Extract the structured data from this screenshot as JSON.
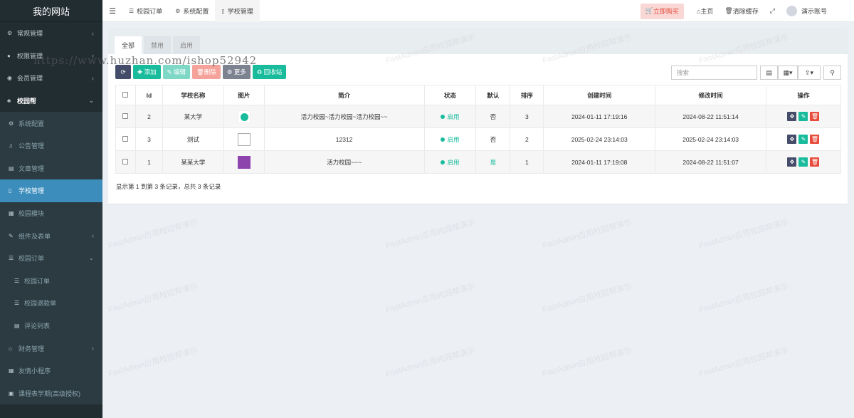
{
  "site_title": "我的网站",
  "overlay_url": "https://www.huzhan.com/ishop52942",
  "watermark": "FastAdmin应用校园帮演示",
  "sidebar": {
    "items": [
      {
        "label": "常规管理",
        "icon": "cogs-icon"
      },
      {
        "label": "权限管理",
        "icon": "users-icon"
      },
      {
        "label": "会员管理",
        "icon": "user-circle-icon"
      },
      {
        "label": "校园帮",
        "icon": "sitemap-icon"
      },
      {
        "label": "系统配置",
        "icon": "cogs-icon"
      },
      {
        "label": "公告管理",
        "icon": "bell-icon"
      },
      {
        "label": "文章管理",
        "icon": "list-alt-icon"
      },
      {
        "label": "学校管理",
        "icon": "file-icon"
      },
      {
        "label": "校园模块",
        "icon": "th-icon"
      },
      {
        "label": "组件及表单",
        "icon": "edit-icon"
      },
      {
        "label": "校园订单",
        "icon": "list-icon"
      },
      {
        "label": "校园订单",
        "icon": "list-icon"
      },
      {
        "label": "校园退款单",
        "icon": "list-icon"
      },
      {
        "label": "评论列表",
        "icon": "list-alt-icon"
      },
      {
        "label": "财务管理",
        "icon": "bank-icon"
      },
      {
        "label": "友情小程序",
        "icon": "th-icon"
      },
      {
        "label": "课程表学期(高级授权)",
        "icon": "calendar-icon"
      }
    ]
  },
  "topbar": {
    "tabs": [
      {
        "label": "校园订单"
      },
      {
        "label": "系统配置"
      },
      {
        "label": "学校管理"
      }
    ],
    "buy": "立即购买",
    "home": "主页",
    "clear_cache": "清除缓存",
    "account": "演示账号"
  },
  "filter_tabs": [
    "全部",
    "禁用",
    "启用"
  ],
  "toolbar": {
    "add": "添加",
    "edit": "编辑",
    "delete": "删除",
    "more": "更多",
    "recycle": "回收站",
    "search_placeholder": "搜索"
  },
  "table": {
    "headers": [
      "Id",
      "学校名称",
      "图片",
      "简介",
      "状态",
      "默认",
      "排序",
      "创建时间",
      "修改时间",
      "操作"
    ],
    "rows": [
      {
        "id": "2",
        "name": "某大学",
        "desc": "活力校园~活力校园~活力校园~~",
        "status": "启用",
        "default": "否",
        "sort": "3",
        "created": "2024-01-11 17:19:16",
        "updated": "2024-08-22 11:51:14"
      },
      {
        "id": "3",
        "name": "测试",
        "desc": "12312",
        "status": "启用",
        "default": "否",
        "sort": "2",
        "created": "2025-02-24 23:14:03",
        "updated": "2025-02-24 23:14:03"
      },
      {
        "id": "1",
        "name": "某某大学",
        "desc": "活力校园~~~",
        "status": "启用",
        "default": "是",
        "sort": "1",
        "created": "2024-01-11 17:19:08",
        "updated": "2024-08-22 11:51:07"
      }
    ]
  },
  "page_info": "显示第 1 到第 3 条记录，总共 3 条记录"
}
